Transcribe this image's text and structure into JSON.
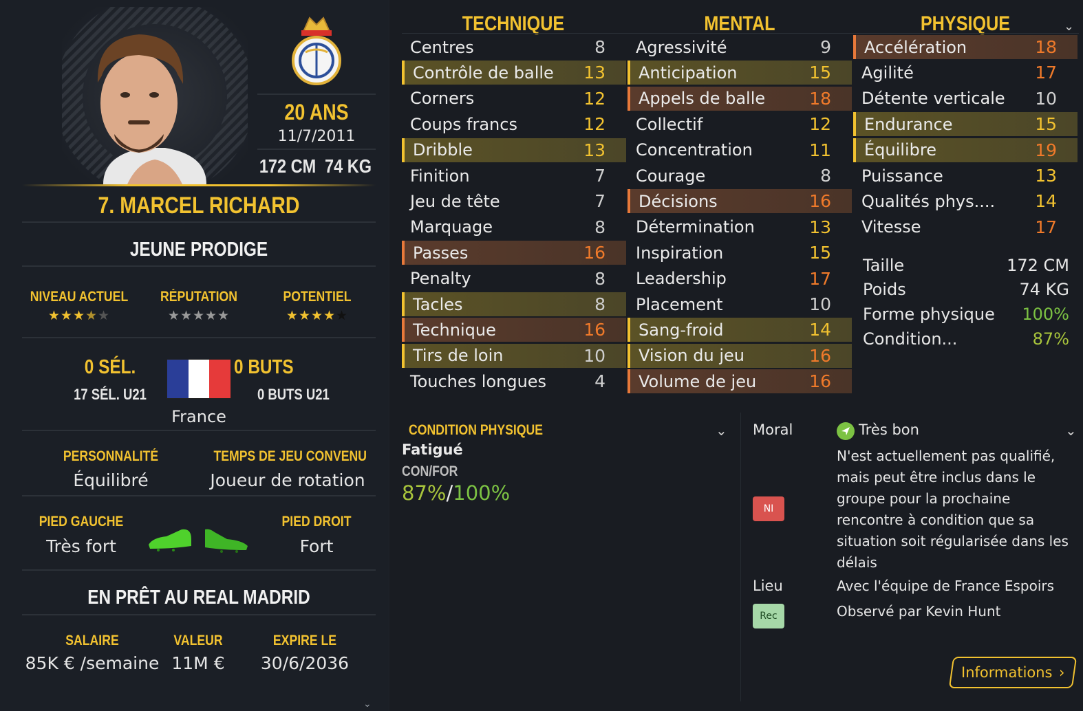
{
  "player": {
    "name": "7. MARCEL RICHARD",
    "age": "20 ANS",
    "dob": "11/7/2011",
    "height": "172 CM",
    "weight": "74 KG",
    "status": "JEUNE PRODIGE",
    "ratings": [
      {
        "label": "NIVEAU ACTUEL",
        "stars": 3.5,
        "max": 5
      },
      {
        "label": "RÉPUTATION",
        "stars": 0,
        "max": 5
      },
      {
        "label": "POTENTIEL",
        "stars": 4,
        "max": 5
      }
    ],
    "caps": "0 SÉL.",
    "caps_u21": "17 SÉL. U21",
    "goals": "0 BUTS",
    "goals_u21": "0 BUTS U21",
    "nation": "France",
    "personality_label": "PERSONNALITÉ",
    "personality": "Équilibré",
    "playtime_label": "TEMPS DE JEU CONVENU",
    "playtime": "Joueur de rotation",
    "left_foot_label": "PIED GAUCHE",
    "left_foot": "Très fort",
    "right_foot_label": "PIED DROIT",
    "right_foot": "Fort",
    "loan": "EN PRÊT AU REAL MADRID",
    "salary_label": "SALAIRE",
    "salary": "85K € /semaine",
    "value_label": "VALEUR",
    "value": "11M €",
    "expires_label": "EXPIRE LE",
    "expires": "30/6/2036"
  },
  "columns": {
    "technique": {
      "title": "TECHNIQUE",
      "rows": [
        {
          "name": "Centres",
          "value": "8",
          "hl": "",
          "c": "w"
        },
        {
          "name": "Contrôle de balle",
          "value": "13",
          "hl": "y",
          "c": "y"
        },
        {
          "name": "Corners",
          "value": "12",
          "hl": "",
          "c": "y"
        },
        {
          "name": "Coups francs",
          "value": "12",
          "hl": "",
          "c": "y"
        },
        {
          "name": "Dribble",
          "value": "13",
          "hl": "y",
          "c": "y"
        },
        {
          "name": "Finition",
          "value": "7",
          "hl": "",
          "c": "w"
        },
        {
          "name": "Jeu de tête",
          "value": "7",
          "hl": "",
          "c": "w"
        },
        {
          "name": "Marquage",
          "value": "8",
          "hl": "",
          "c": "w"
        },
        {
          "name": "Passes",
          "value": "16",
          "hl": "o",
          "c": "o"
        },
        {
          "name": "Penalty",
          "value": "8",
          "hl": "",
          "c": "w"
        },
        {
          "name": "Tacles",
          "value": "8",
          "hl": "y",
          "c": "w"
        },
        {
          "name": "Technique",
          "value": "16",
          "hl": "o",
          "c": "o"
        },
        {
          "name": "Tirs de loin",
          "value": "10",
          "hl": "y",
          "c": "w"
        },
        {
          "name": "Touches longues",
          "value": "4",
          "hl": "",
          "c": "w"
        }
      ]
    },
    "mental": {
      "title": "MENTAL",
      "rows": [
        {
          "name": "Agressivité",
          "value": "9",
          "hl": "",
          "c": "w"
        },
        {
          "name": "Anticipation",
          "value": "15",
          "hl": "y",
          "c": "y"
        },
        {
          "name": "Appels de balle",
          "value": "18",
          "hl": "o",
          "c": "o"
        },
        {
          "name": "Collectif",
          "value": "12",
          "hl": "",
          "c": "y"
        },
        {
          "name": "Concentration",
          "value": "11",
          "hl": "",
          "c": "y"
        },
        {
          "name": "Courage",
          "value": "8",
          "hl": "",
          "c": "w"
        },
        {
          "name": "Décisions",
          "value": "16",
          "hl": "o",
          "c": "o"
        },
        {
          "name": "Détermination",
          "value": "13",
          "hl": "",
          "c": "y"
        },
        {
          "name": "Inspiration",
          "value": "15",
          "hl": "",
          "c": "y"
        },
        {
          "name": "Leadership",
          "value": "17",
          "hl": "",
          "c": "o"
        },
        {
          "name": "Placement",
          "value": "10",
          "hl": "",
          "c": "w"
        },
        {
          "name": "Sang-froid",
          "value": "14",
          "hl": "y",
          "c": "y"
        },
        {
          "name": "Vision du jeu",
          "value": "16",
          "hl": "y",
          "c": "o"
        },
        {
          "name": "Volume de jeu",
          "value": "16",
          "hl": "o",
          "c": "o"
        }
      ]
    },
    "physique": {
      "title": "PHYSIQUE",
      "rows": [
        {
          "name": "Accélération",
          "value": "18",
          "hl": "o",
          "c": "o"
        },
        {
          "name": "Agilité",
          "value": "17",
          "hl": "",
          "c": "o"
        },
        {
          "name": "Détente verticale",
          "value": "10",
          "hl": "",
          "c": "w"
        },
        {
          "name": "Endurance",
          "value": "15",
          "hl": "y",
          "c": "y"
        },
        {
          "name": "Équilibre",
          "value": "19",
          "hl": "y",
          "c": "o"
        },
        {
          "name": "Puissance",
          "value": "13",
          "hl": "",
          "c": "y"
        },
        {
          "name": "Qualités phys....",
          "value": "14",
          "hl": "",
          "c": "y"
        },
        {
          "name": "Vitesse",
          "value": "17",
          "hl": "",
          "c": "o"
        }
      ]
    }
  },
  "physical_info": [
    {
      "label": "Taille",
      "value": "172 CM",
      "color": "#eaeaea"
    },
    {
      "label": "Poids",
      "value": "74 KG",
      "color": "#eaeaea"
    },
    {
      "label": "Forme physique",
      "value": "100%",
      "color": "#7cc243"
    },
    {
      "label": "Condition...",
      "value": "87%",
      "color": "#a8c43c"
    }
  ],
  "condition": {
    "title": "CONDITION PHYSIQUE",
    "state": "Fatigué",
    "label": "CON/FOR",
    "con": "87%",
    "sep": "/",
    "for": "100%"
  },
  "morale": {
    "label": "Moral",
    "value": "Très bon",
    "note": "N'est actuellement pas qualifié, mais peut être inclus dans le groupe pour la prochaine rencontre à condition que sa situation soit régularisée dans les délais",
    "tag_ni": "NI",
    "location_label": "Lieu",
    "location": "Avec l'équipe de France Espoirs",
    "tag_rec": "Rec",
    "scout": "Observé par Kevin Hunt"
  },
  "actions": {
    "info_button": "Informations"
  },
  "colors": {
    "gold": "#f2c230",
    "orange": "#f07a2a",
    "green": "#7cc243",
    "ni": "#d9534f",
    "rec": "#a6d8a8"
  }
}
